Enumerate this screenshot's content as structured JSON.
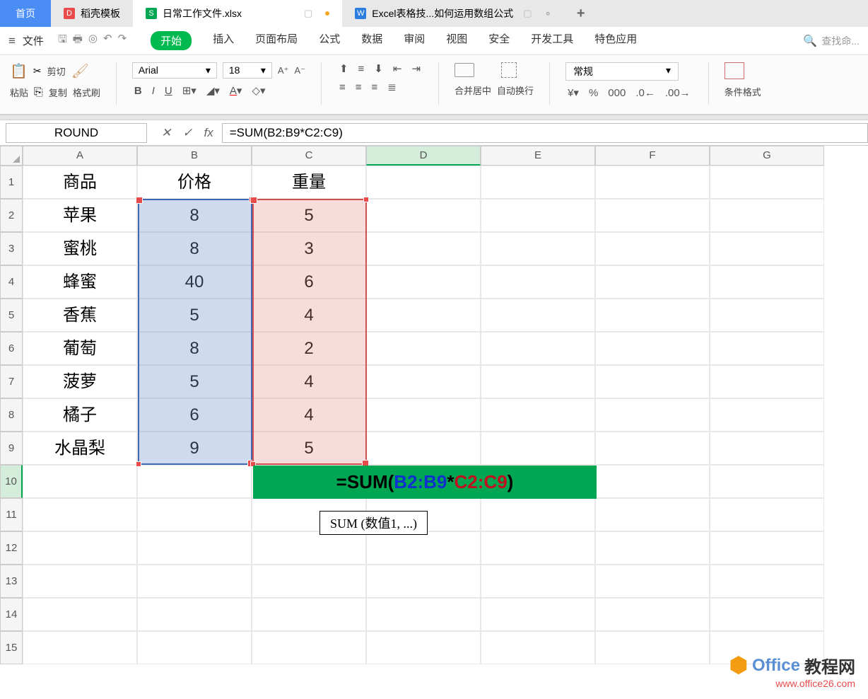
{
  "tabs": {
    "home": "首页",
    "template": "稻壳模板",
    "file": "日常工作文件.xlsx",
    "excel_tip": "Excel表格技...如何运用数组公式"
  },
  "menu": {
    "file": "文件",
    "start": "开始",
    "insert": "插入",
    "layout": "页面布局",
    "formula": "公式",
    "data": "数据",
    "review": "审阅",
    "view": "视图",
    "security": "安全",
    "devtools": "开发工具",
    "special": "特色应用",
    "search": "查找命..."
  },
  "ribbon": {
    "paste": "粘贴",
    "cut": "剪切",
    "copy": "复制",
    "format_painter": "格式刷",
    "font_name": "Arial",
    "font_size": "18",
    "merge": "合并居中",
    "wrap": "自动换行",
    "number_format": "常规",
    "cond_format": "条件格式"
  },
  "formula_bar": {
    "name_box": "ROUND",
    "formula": "=SUM(B2:B9*C2:C9)"
  },
  "columns": [
    "A",
    "B",
    "C",
    "D",
    "E",
    "F",
    "G"
  ],
  "rows": [
    "1",
    "2",
    "3",
    "4",
    "5",
    "6",
    "7",
    "8",
    "9",
    "10",
    "11",
    "12",
    "13",
    "14",
    "15"
  ],
  "chart_data": {
    "type": "table",
    "headers": {
      "A": "商品",
      "B": "价格",
      "C": "重量"
    },
    "data": [
      {
        "A": "苹果",
        "B": 8,
        "C": 5
      },
      {
        "A": "蜜桃",
        "B": 8,
        "C": 3
      },
      {
        "A": "蜂蜜",
        "B": 40,
        "C": 6
      },
      {
        "A": "香蕉",
        "B": 5,
        "C": 4
      },
      {
        "A": "葡萄",
        "B": 8,
        "C": 2
      },
      {
        "A": "菠萝",
        "B": 5,
        "C": 4
      },
      {
        "A": "橘子",
        "B": 6,
        "C": 4
      },
      {
        "A": "水晶梨",
        "B": 9,
        "C": 5
      }
    ]
  },
  "cell_formula": {
    "prefix": "=SUM(",
    "r1": "B2:B9",
    "mid": " * ",
    "r2": "C2:C9",
    "suffix": ")"
  },
  "tooltip": "SUM (数值1, ...)",
  "watermark": {
    "brand": "Office",
    "cn": "教程网",
    "url": "www.office26.com"
  }
}
